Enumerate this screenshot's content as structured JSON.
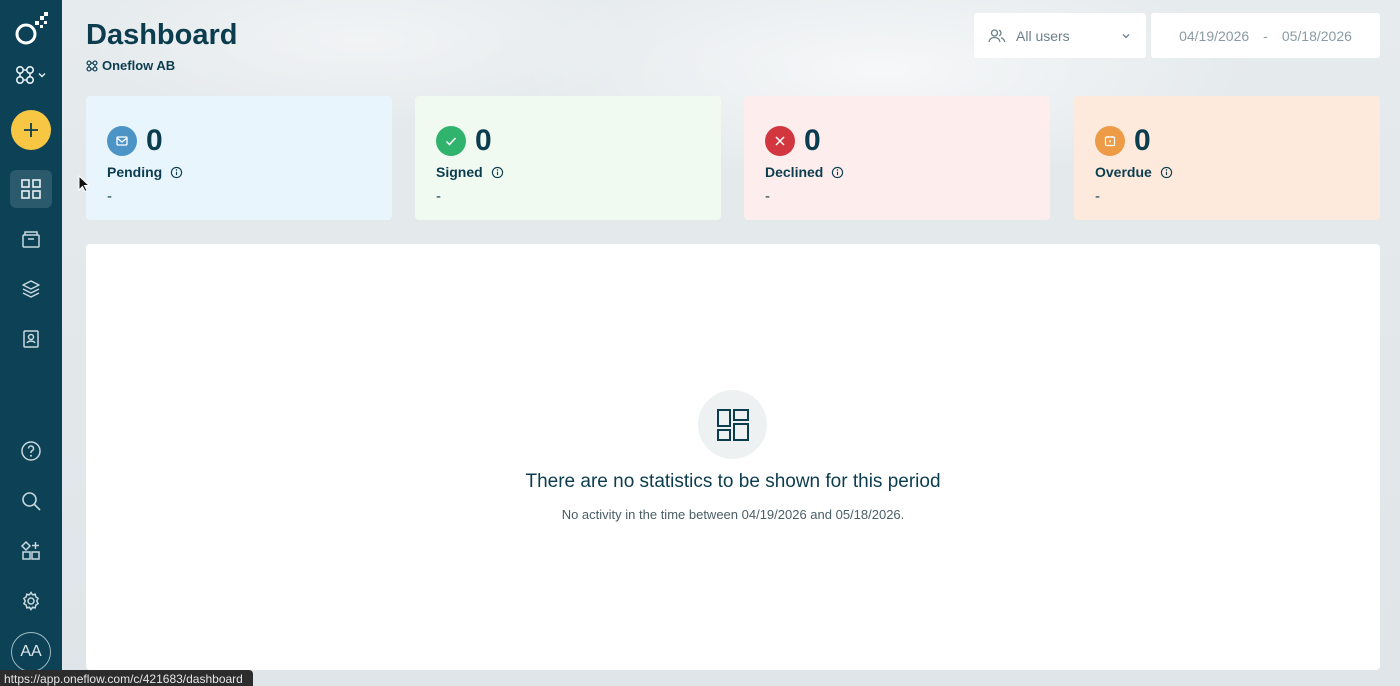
{
  "header": {
    "title": "Dashboard",
    "workspace": "Oneflow AB"
  },
  "filters": {
    "user_select": "All users",
    "date_from": "04/19/2026",
    "date_separator": "-",
    "date_to": "05/18/2026"
  },
  "cards": [
    {
      "key": "pending",
      "count": "0",
      "label": "Pending",
      "value": "-",
      "bg": "#e8f5fd",
      "icon_bg": "#4d94c6",
      "icon": "envelope-icon"
    },
    {
      "key": "signed",
      "count": "0",
      "label": "Signed",
      "value": "-",
      "bg": "#f1faf1",
      "icon_bg": "#2fb36d",
      "icon": "check-icon"
    },
    {
      "key": "declined",
      "count": "0",
      "label": "Declined",
      "value": "-",
      "bg": "#fdeeed",
      "icon_bg": "#d2373f",
      "icon": "close-icon"
    },
    {
      "key": "overdue",
      "count": "0",
      "label": "Overdue",
      "value": "-",
      "bg": "#fdeadc",
      "icon_bg": "#ee9b48",
      "icon": "calendar-icon"
    }
  ],
  "empty_state": {
    "title": "There are no statistics to be shown for this period",
    "description": "No activity in the time between 04/19/2026 and 05/18/2026."
  },
  "sidebar": {
    "avatar_initials": "AA",
    "create_color": "#f7c744",
    "bg_color": "#0c4156"
  },
  "status_bar": {
    "url": "https://app.oneflow.com/c/421683/dashboard"
  }
}
